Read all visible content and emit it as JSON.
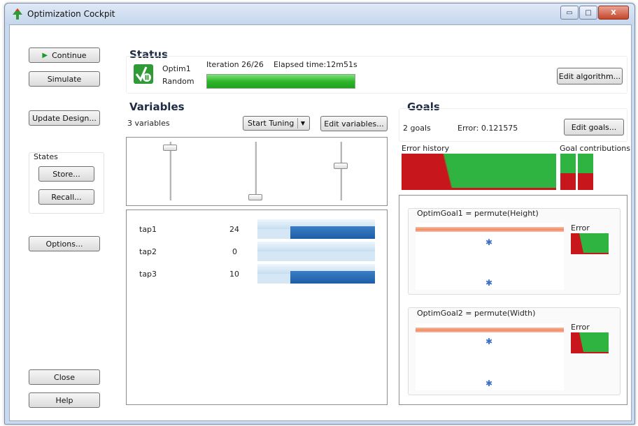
{
  "window": {
    "title": "Optimization Cockpit",
    "controls": {
      "minimize": "▭",
      "maximize": "□",
      "close": "X"
    }
  },
  "left": {
    "continue_label": "Continue",
    "simulate_label": "Simulate",
    "update_design_label": "Update Design...",
    "states_title": "States",
    "store_label": "Store...",
    "recall_label": "Recall...",
    "options_label": "Options...",
    "close_label": "Close",
    "help_label": "Help"
  },
  "status": {
    "title": "Status",
    "optimizer": "Optim1",
    "mode": "Random",
    "iteration": "Iteration 26/26",
    "elapsed": "Elapsed time:12m51s",
    "progress": 1.0,
    "edit_algorithm_label": "Edit algorithm..."
  },
  "variables": {
    "title": "Variables",
    "count_text": "3 variables",
    "start_tuning_label": "Start Tuning",
    "edit_variables_label": "Edit variables...",
    "slider_levels": [
      0.95,
      0.0,
      0.6
    ],
    "items": [
      {
        "name": "tap1",
        "value": "24",
        "fill": 0.72
      },
      {
        "name": "tap2",
        "value": "0",
        "fill": 0.0
      },
      {
        "name": "tap3",
        "value": "10",
        "fill": 0.72
      }
    ]
  },
  "goals": {
    "title": "Goals",
    "count_text": "2 goals",
    "error_text": "Error:  0.121575",
    "edit_goals_label": "Edit goals...",
    "error_history_label": "Error history",
    "goal_contributions_label": "Goal contributions",
    "goal1": {
      "title": "OptimGoal1 = permute(Height)",
      "error_label": "Error"
    },
    "goal2": {
      "title": "OptimGoal2 = permute(Width)",
      "error_label": "Error"
    }
  },
  "colors": {
    "error_red": "#c8161d",
    "error_green": "#2fb441",
    "bar_blue": "#1d5ea8",
    "progress_green": "#2eb62a"
  }
}
